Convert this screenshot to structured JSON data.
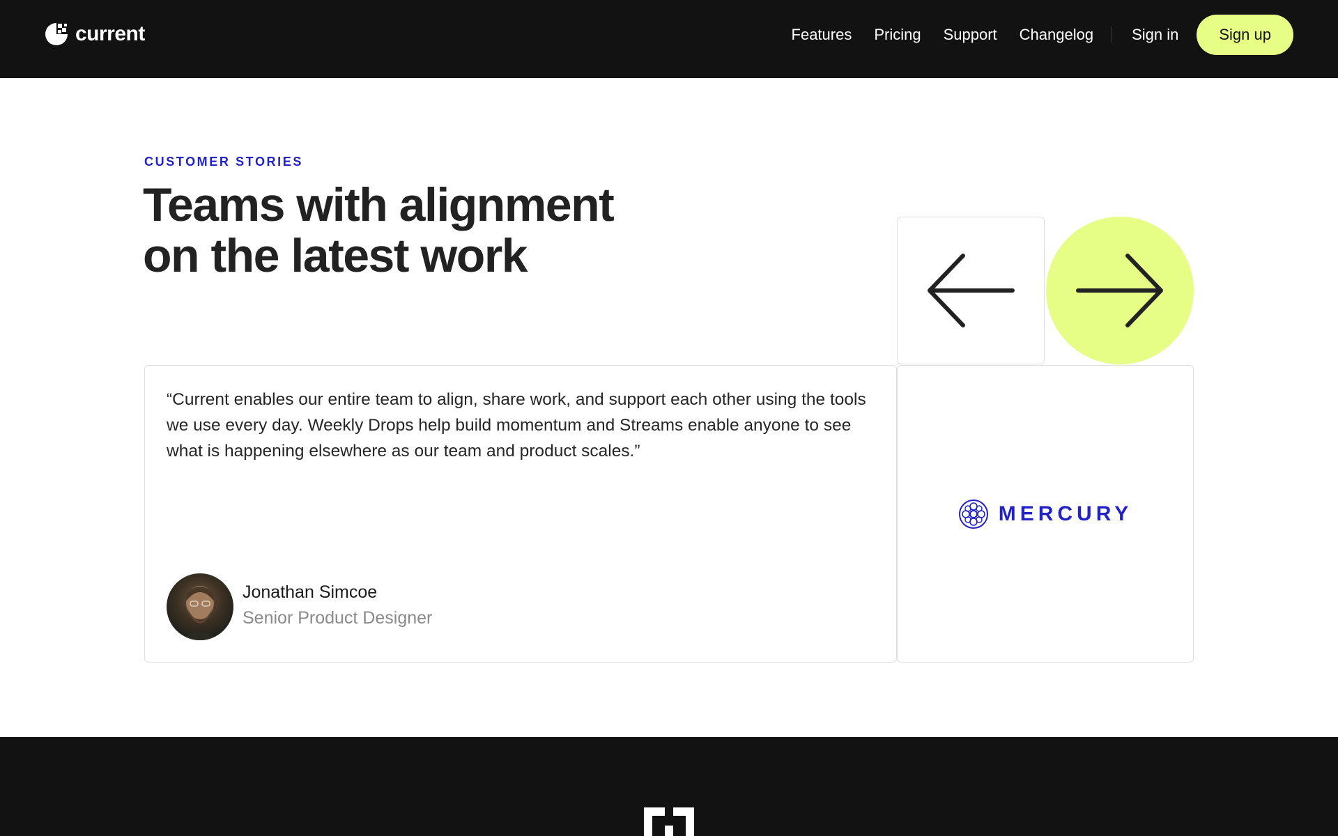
{
  "nav": {
    "logo_text": "current",
    "links": [
      "Features",
      "Pricing",
      "Support",
      "Changelog"
    ],
    "sign_in": "Sign in",
    "sign_up": "Sign up"
  },
  "stories": {
    "eyebrow": "CUSTOMER STORIES",
    "headline_line1": "Teams with alignment",
    "headline_line2": "on the latest work",
    "quote": "“Current enables our entire team to align, share work, and support each other using the tools we use every day. Weekly Drops help build momentum and Streams enable anyone to see what is happening elsewhere as our team and product scales.”",
    "author_name": "Jonathan Simcoe",
    "author_title": "Senior Product Designer",
    "company_logo_text": "MERCURY"
  },
  "icons": {
    "brand": "current-logo-icon",
    "prev": "arrow-left-icon",
    "next": "arrow-right-icon",
    "company": "mercury-logo-icon",
    "footer": "footer-logo-icon"
  },
  "colors": {
    "nav_background": "#121212",
    "accent_lime": "#e6fd86",
    "accent_blue": "#2222c8",
    "border": "#dedede"
  }
}
